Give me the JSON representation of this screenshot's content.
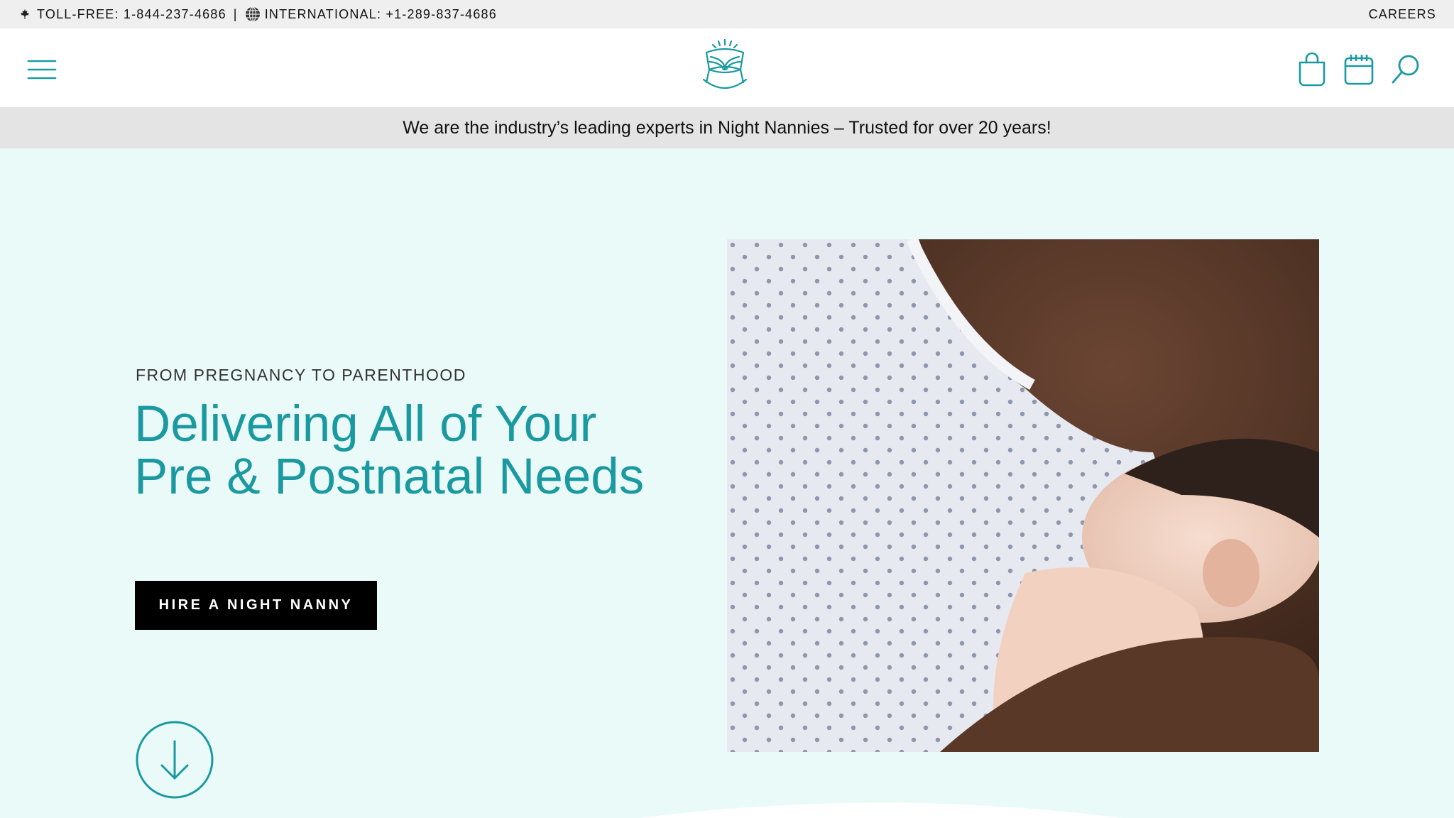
{
  "topbar": {
    "toll_free": "TOLL-FREE: 1-844-237-4686",
    "separator": "|",
    "international": "INTERNATIONAL: +1-289-837-4686",
    "careers": "CAREERS"
  },
  "header": {
    "icons": [
      "menu-icon",
      "logo",
      "shopping-bag-icon",
      "calendar-icon",
      "search-icon"
    ]
  },
  "announcement": {
    "text": "We are the industry’s leading experts in Night Nannies – Trusted for over 20 years!"
  },
  "hero": {
    "eyebrow": "FROM PREGNANCY TO PARENTHOOD",
    "headline": "Delivering All of Your Pre & Postnatal Needs",
    "cta_label": "HIRE A NIGHT NANNY",
    "scroll_icon": "arrow-down-circle-icon"
  },
  "colors": {
    "brand_teal": "#1a9aa0",
    "hero_bg": "#eafaf9",
    "announce_bg": "#e4e4e4",
    "topbar_bg": "#efefef"
  }
}
